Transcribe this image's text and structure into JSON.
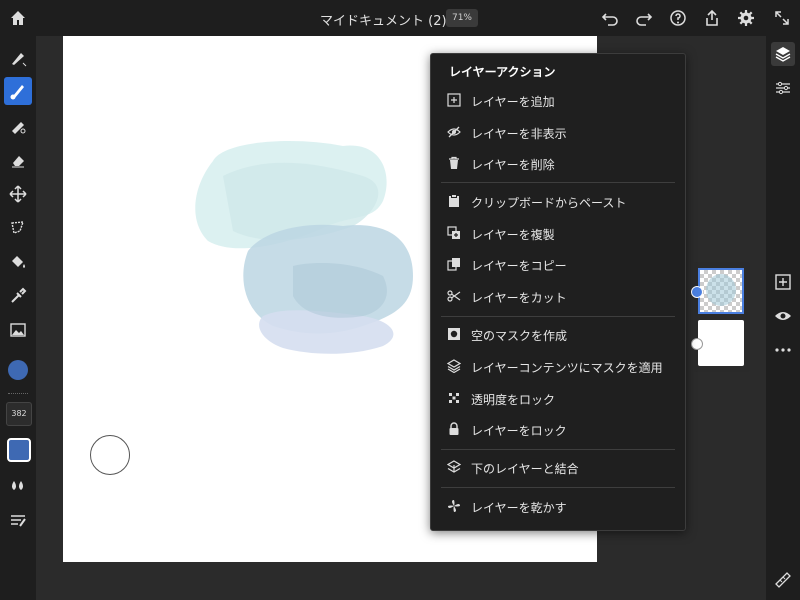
{
  "header": {
    "document_title": "マイドキュメント (2)",
    "zoom": "71%"
  },
  "left_toolbar": {
    "brush_size": "382",
    "current_color": "#3e69b3"
  },
  "menu": {
    "title": "レイヤーアクション",
    "items": [
      {
        "label": "レイヤーを追加",
        "icon": "add-box-icon"
      },
      {
        "label": "レイヤーを非表示",
        "icon": "eye-off-icon"
      },
      {
        "label": "レイヤーを削除",
        "icon": "trash-icon"
      },
      {
        "label": "クリップボードからペースト",
        "icon": "clipboard-icon"
      },
      {
        "label": "レイヤーを複製",
        "icon": "duplicate-icon"
      },
      {
        "label": "レイヤーをコピー",
        "icon": "copy-icon"
      },
      {
        "label": "レイヤーをカット",
        "icon": "scissors-icon"
      },
      {
        "label": "空のマスクを作成",
        "icon": "mask-icon"
      },
      {
        "label": "レイヤーコンテンツにマスクを適用",
        "icon": "layers-mask-icon"
      },
      {
        "label": "透明度をロック",
        "icon": "transparency-lock-icon"
      },
      {
        "label": "レイヤーをロック",
        "icon": "lock-icon"
      },
      {
        "label": "下のレイヤーと結合",
        "icon": "merge-down-icon"
      },
      {
        "label": "レイヤーを乾かす",
        "icon": "fan-icon"
      }
    ]
  }
}
